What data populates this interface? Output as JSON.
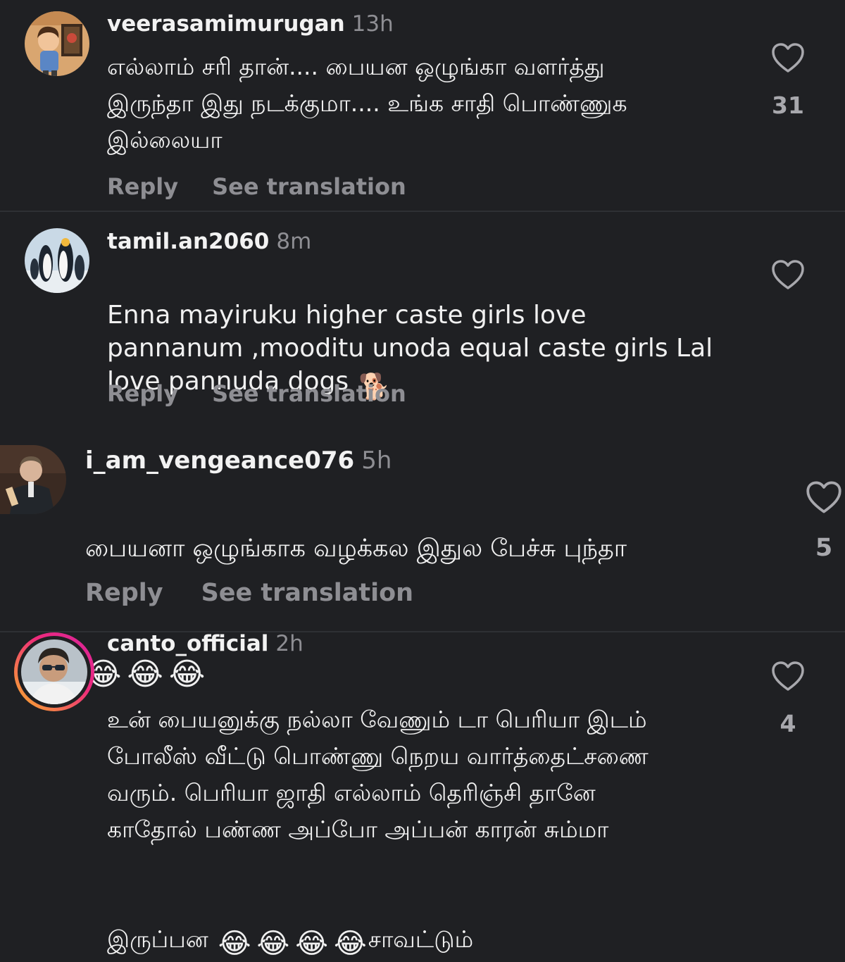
{
  "comments": [
    {
      "username": "veerasamimurugan",
      "time": "13h",
      "text": "எல்லாம் சரி தான்.... பையன ஒழுங்கா வளர்த்து\nஇருந்தா இது நடக்குமா.... உங்க சாதி பொண்ணுக\nஇல்லையா",
      "reply_label": "Reply",
      "translate_label": "See translation",
      "likes": "31",
      "avatar_icon": "cartoon-boy-avatar"
    },
    {
      "username": "tamil.an2060",
      "time": "8m",
      "text": "Enna mayiruku higher caste girls love\npannanum ,mooditu unoda equal caste girls Lal\nlove pannuda dogs",
      "emoji": "🐕",
      "reply_label": "Reply",
      "translate_label": "See translation",
      "likes": "",
      "avatar_icon": "penguins-avatar"
    },
    {
      "username": "i_am_vengeance076",
      "time": "5h",
      "text": "பையனா ஒழுங்காக வழக்கல இதுல பேச்சு புந்தா",
      "emojis": [
        "😂",
        "😂",
        "😂"
      ],
      "reply_label": "Reply",
      "translate_label": "See translation",
      "likes": "5",
      "avatar_icon": "man-in-suit-avatar"
    },
    {
      "username": "canto_official",
      "time": "2h",
      "text": "உன் பையனுக்கு நல்லா வேணும் டா பெரியா இடம்\nபோலீஸ் வீட்டு பொண்ணு நெறய வார்த்தைட்சணை\nவரும். பெரியா ஜாதி எல்லாம் தெரிஞ்சி தானே\nகாதோல் பண்ண அப்போ அப்பன் காரன் சும்மா",
      "last_line_start": "இருப்பன",
      "last_line_end": "சாவட்டும்",
      "emojis": [
        "😂",
        "😂",
        "😂",
        "😂"
      ],
      "likes": "4",
      "avatar_icon": "man-with-sunglasses-avatar"
    }
  ],
  "colors": {
    "background": "#1f2023",
    "divider": "#2e3034",
    "secondary_text": "#8e8e93",
    "story_ring_start": "#f9b528",
    "story_ring_end": "#d6249f"
  }
}
